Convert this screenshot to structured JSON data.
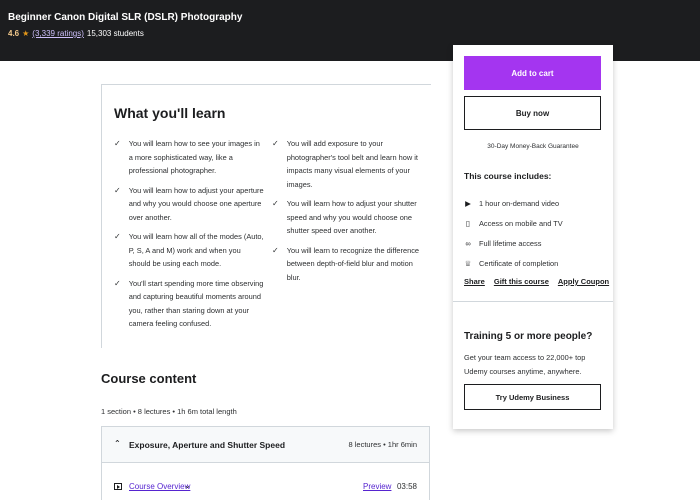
{
  "header": {
    "title": "Beginner Canon Digital SLR (DSLR) Photography",
    "rating": "4.6",
    "star_icon": "star-icon",
    "ratings_count": "(3,339 ratings)",
    "students": "15,303 students"
  },
  "learn": {
    "title": "What you'll learn",
    "left_items": [
      "You will learn how to see your images in a more sophisticated way, like a professional photographer.",
      "You will learn how to adjust your aperture and why you would choose one aperture over another.",
      "You will learn how all of the modes (Auto, P, S, A and M) work and when you should be using each mode.",
      "You'll start spending more time observing and capturing beautiful moments around you, rather than staring down at your camera feeling confused."
    ],
    "right_items": [
      "You will add exposure to your photographer's tool belt and learn how it impacts many visual elements of your images.",
      "You will learn how to adjust your shutter speed and why you would choose one shutter speed over another.",
      "You will learn to recognize the difference between depth-of-field blur and motion blur."
    ]
  },
  "content": {
    "title": "Course content",
    "meta": "1 section • 8 lectures • 1h 6m total length",
    "section": {
      "title": "Exposure, Aperture and Shutter Speed",
      "info": "8 lectures • 1hr 6min"
    },
    "lecture": {
      "title": "Course Overview",
      "preview": "Preview",
      "duration": "03:58"
    }
  },
  "sidebar": {
    "add_to_cart": "Add to cart",
    "buy_now": "Buy now",
    "guarantee": "30-Day Money-Back Guarantee",
    "includes_title": "This course includes:",
    "includes": [
      {
        "icon": "video-icon",
        "glyph": "▶",
        "label": "1 hour on-demand video"
      },
      {
        "icon": "mobile-icon",
        "glyph": "▯",
        "label": "Access on mobile and TV"
      },
      {
        "icon": "infinity-icon",
        "glyph": "∞",
        "label": "Full lifetime access"
      },
      {
        "icon": "trophy-icon",
        "glyph": "♕",
        "label": "Certificate of completion"
      }
    ],
    "share": "Share",
    "gift": "Gift this course",
    "coupon": "Apply Coupon",
    "training_title": "Training 5 or more people?",
    "training_desc": "Get your team access to 22,000+ top Udemy courses anytime, anywhere.",
    "business_button": "Try Udemy Business"
  },
  "colors": {
    "header_bg": "#1c1d1f",
    "accent_purple": "#a435f0",
    "link_purple": "#5624d0",
    "rating_gold": "#f3ca8c"
  }
}
